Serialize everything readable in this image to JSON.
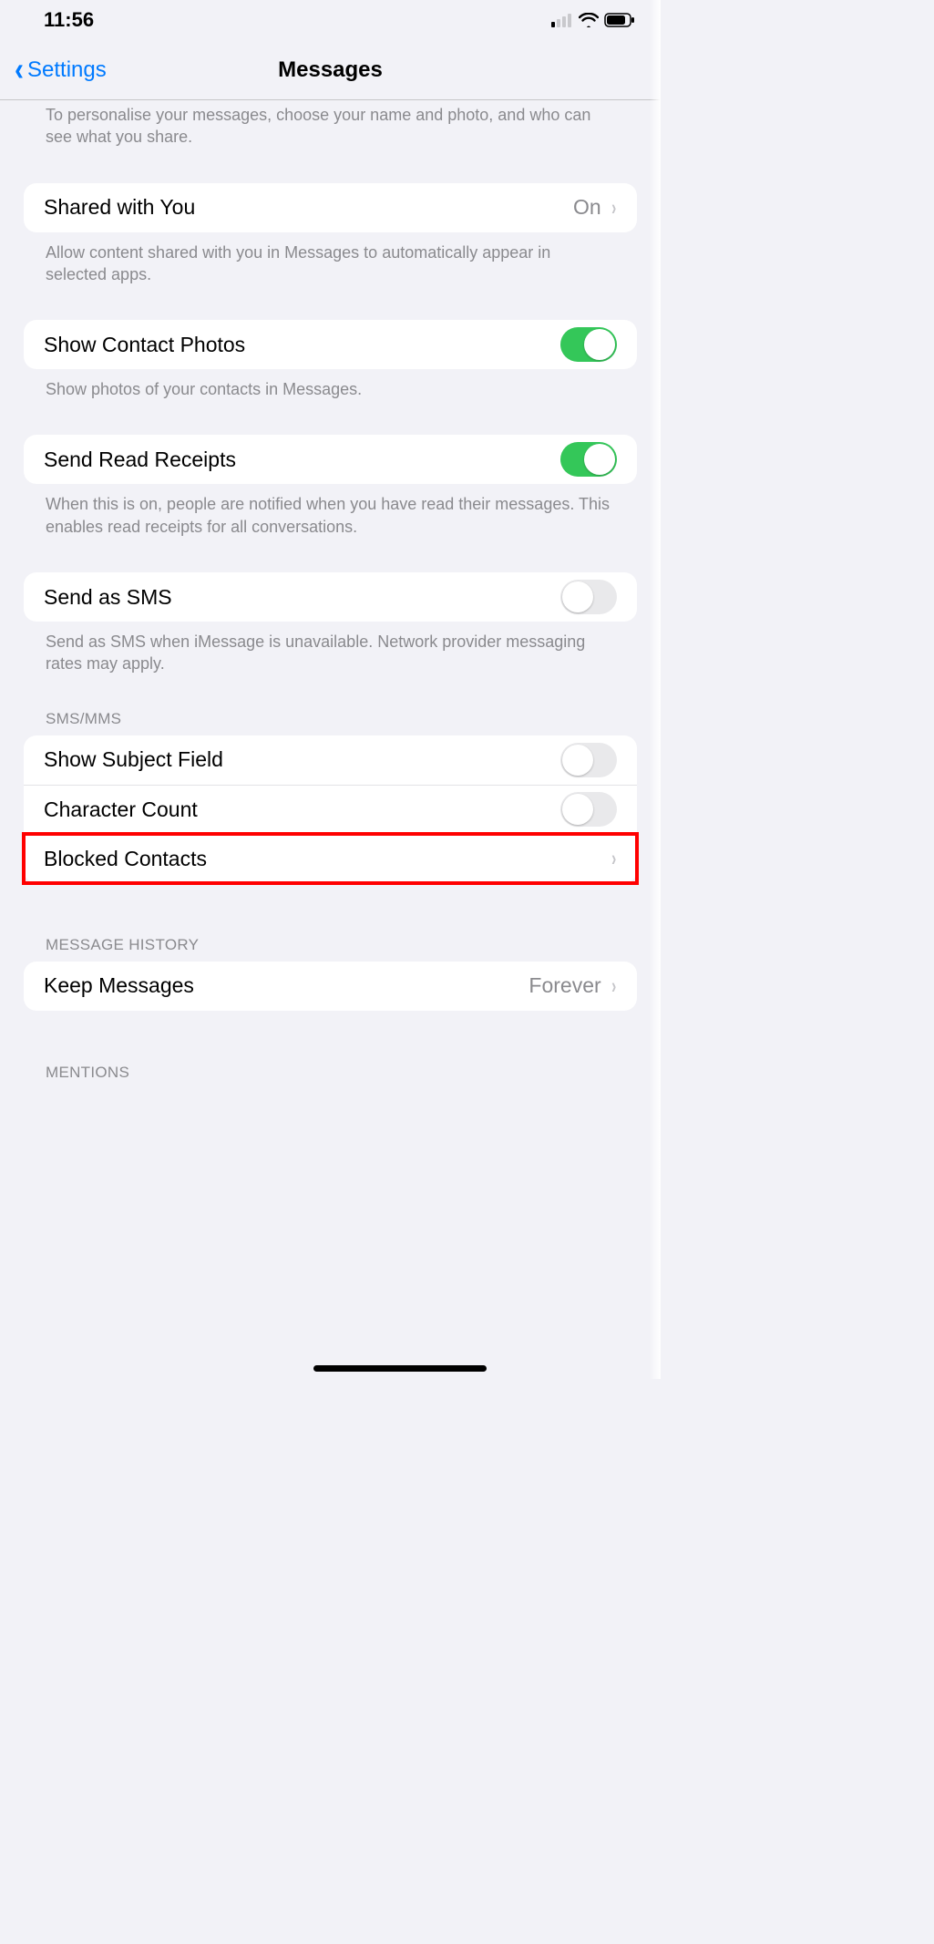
{
  "status": {
    "time": "11:56"
  },
  "nav": {
    "back_label": "Settings",
    "title": "Messages"
  },
  "intro_footer": "To personalise your messages, choose your name and photo, and who can see what you share.",
  "shared_with_you": {
    "label": "Shared with You",
    "value": "On",
    "footer": "Allow content shared with you in Messages to automatically appear in selected apps."
  },
  "contact_photos": {
    "label": "Show Contact Photos",
    "on": true,
    "footer": "Show photos of your contacts in Messages."
  },
  "read_receipts": {
    "label": "Send Read Receipts",
    "on": true,
    "footer": "When this is on, people are notified when you have read their messages. This enables read receipts for all conversations."
  },
  "send_sms": {
    "label": "Send as SMS",
    "on": false,
    "footer": "Send as SMS when iMessage is unavailable. Network provider messaging rates may apply."
  },
  "sms_mms": {
    "header": "SMS/MMS",
    "show_subject": {
      "label": "Show Subject Field",
      "on": false
    },
    "char_count": {
      "label": "Character Count",
      "on": false
    },
    "blocked": {
      "label": "Blocked Contacts"
    }
  },
  "history": {
    "header": "MESSAGE HISTORY",
    "keep": {
      "label": "Keep Messages",
      "value": "Forever"
    }
  },
  "mentions": {
    "header": "MENTIONS"
  }
}
